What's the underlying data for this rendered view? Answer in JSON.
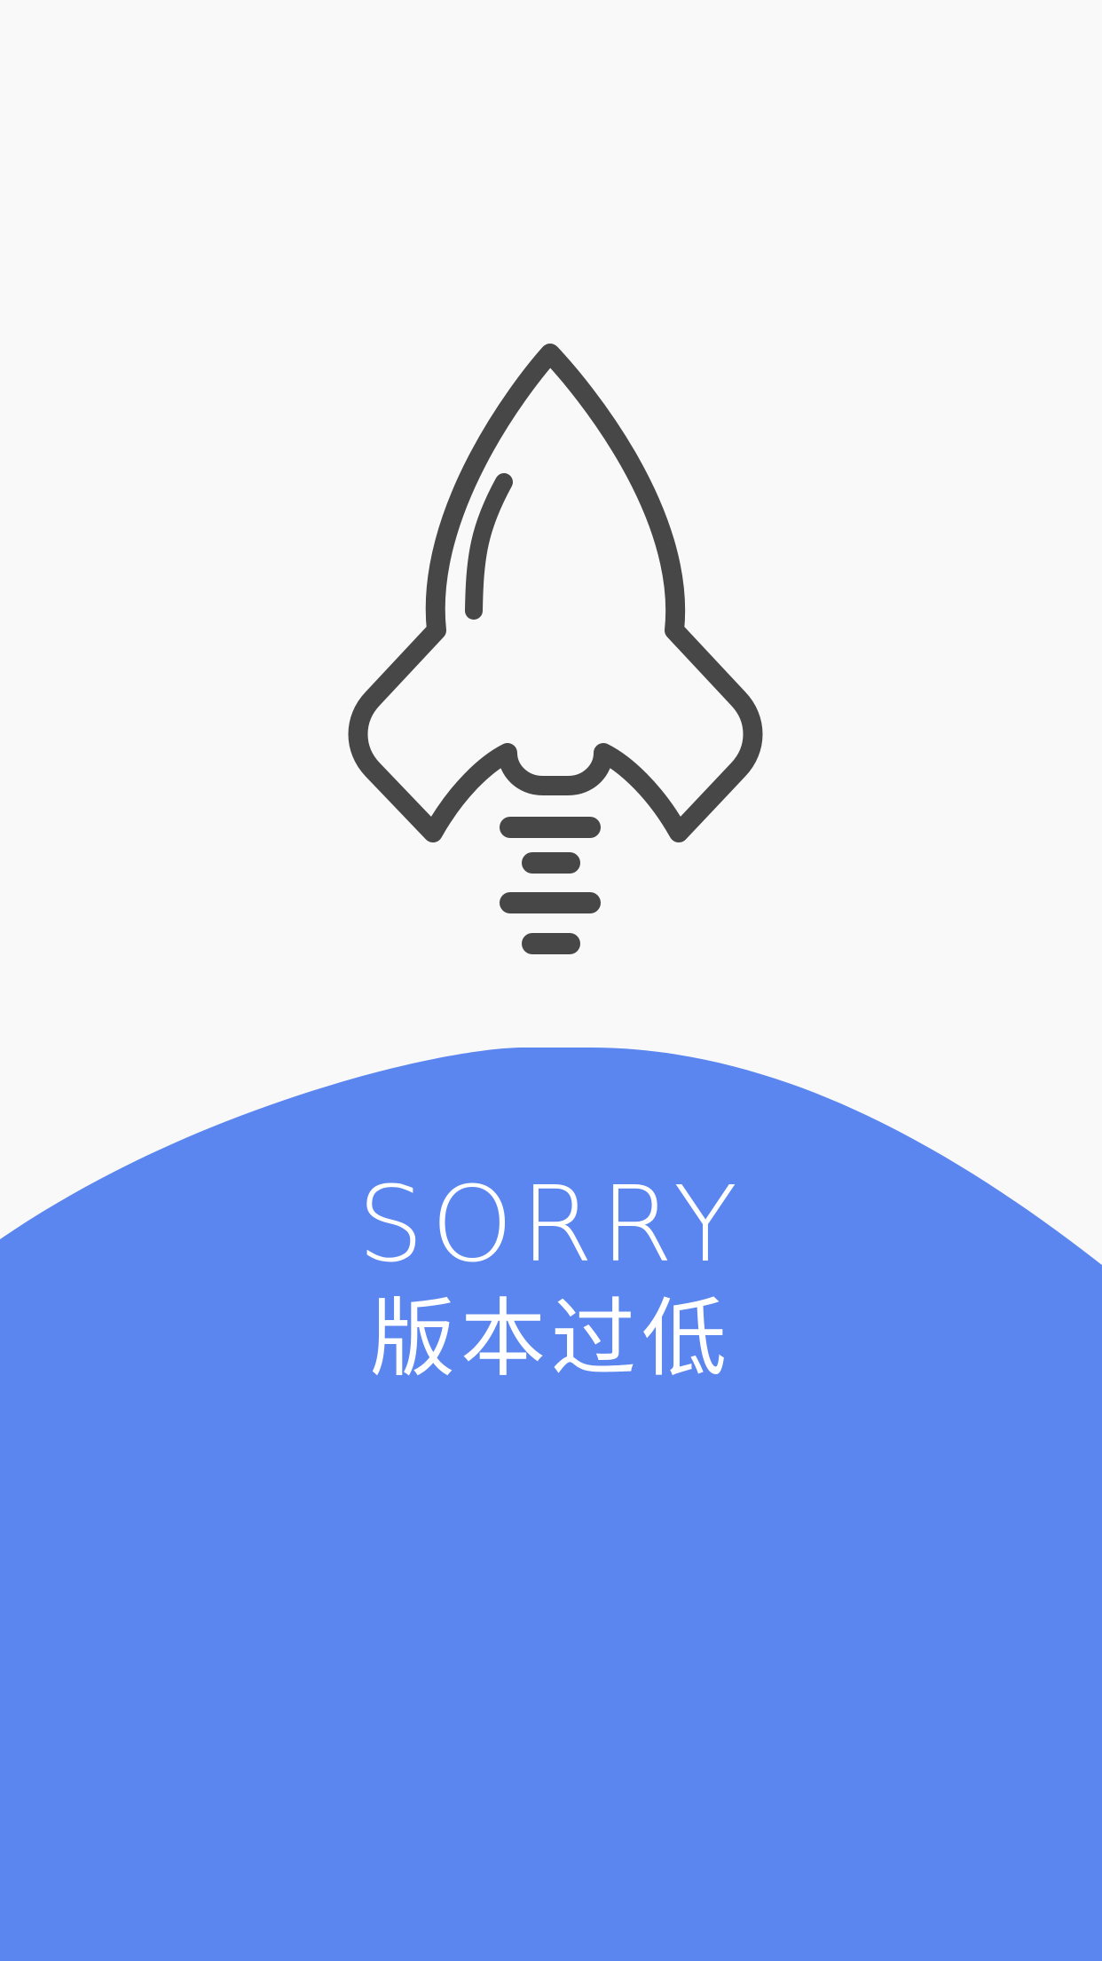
{
  "screen": {
    "title": "SORRY",
    "subtitle": "版本过低"
  },
  "icons": {
    "hero": "rocket-icon"
  },
  "colors": {
    "background": "#f9f9f9",
    "wave": "#5b86f0",
    "icon_stroke": "#474747",
    "text": "#ffffff"
  }
}
